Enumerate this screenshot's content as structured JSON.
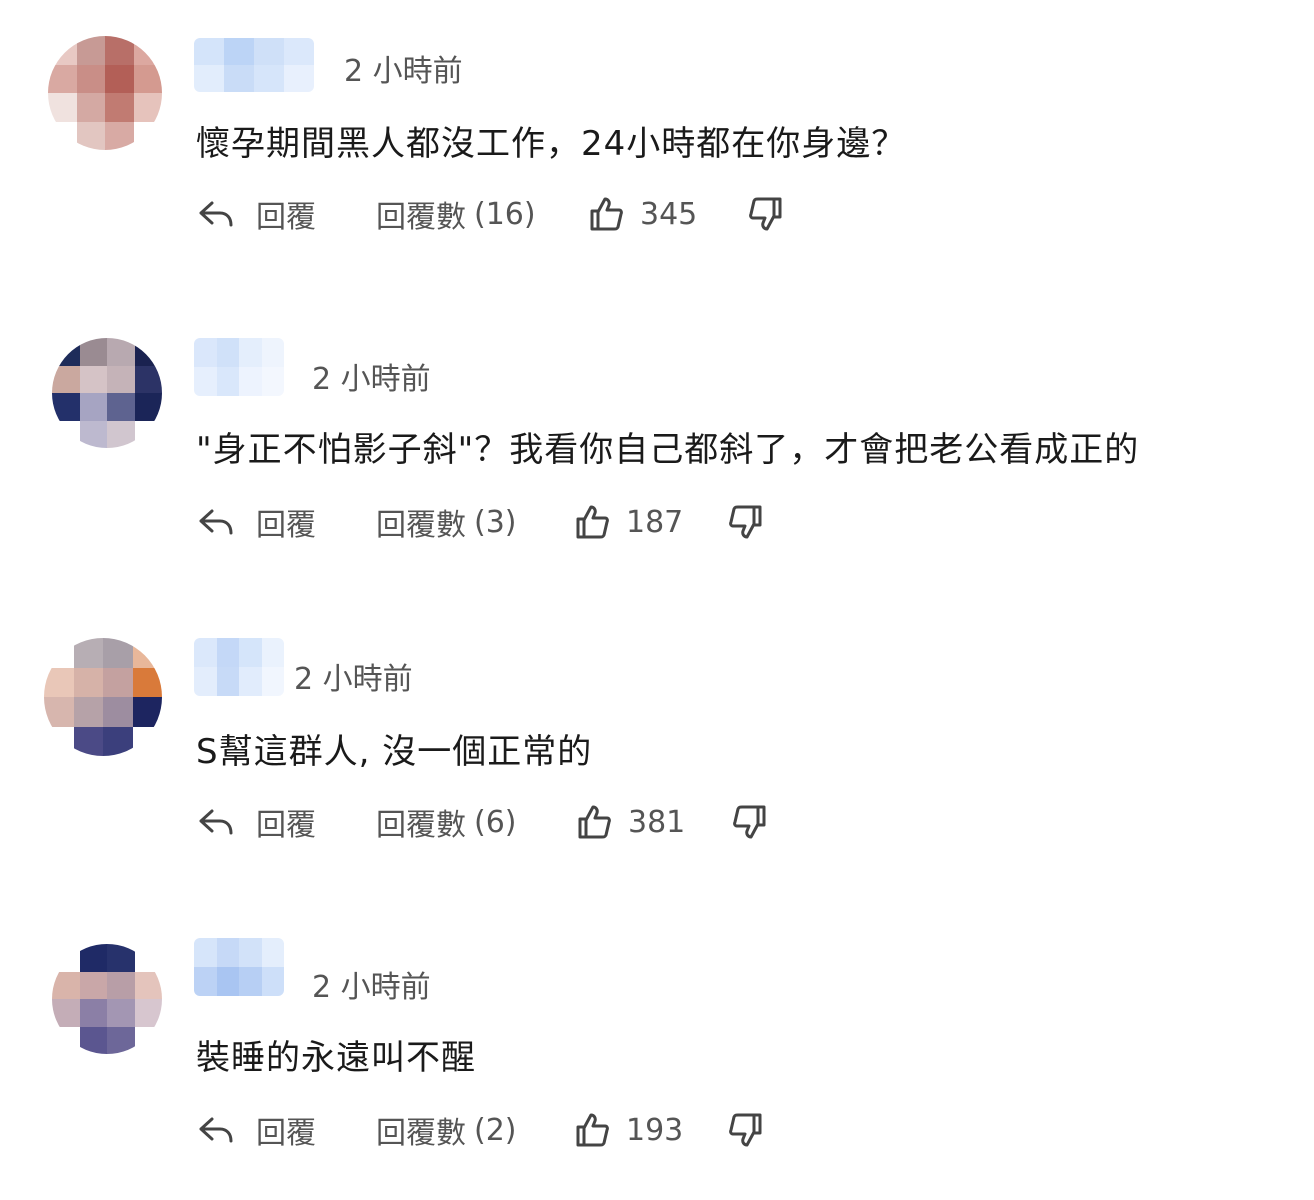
{
  "labels": {
    "reply": "回覆",
    "replies_prefix": "回覆數"
  },
  "comments": [
    {
      "time": "2 小時前",
      "text": "懷孕期間黑人都沒工作，24小時都在你身邊？",
      "reply_count": "(16)",
      "likes": "345"
    },
    {
      "time": "2 小時前",
      "text": "\"身正不怕影子斜\"？我看你自己都斜了，才會把老公看成正的",
      "reply_count": "(3)",
      "likes": "187"
    },
    {
      "time": "2 小時前",
      "text": "S幫這群人, 沒一個正常的",
      "reply_count": "(6)",
      "likes": "381"
    },
    {
      "time": "2 小時前",
      "text": "裝睡的永遠叫不醒",
      "reply_count": "(2)",
      "likes": "193"
    }
  ],
  "icons": {
    "reply": "reply-arrow-icon",
    "like": "thumbs-up-icon",
    "dislike": "thumbs-down-icon"
  },
  "colors": {
    "text": "#1a1a1a",
    "meta": "#555555",
    "name_blur": "#c8daf5"
  }
}
